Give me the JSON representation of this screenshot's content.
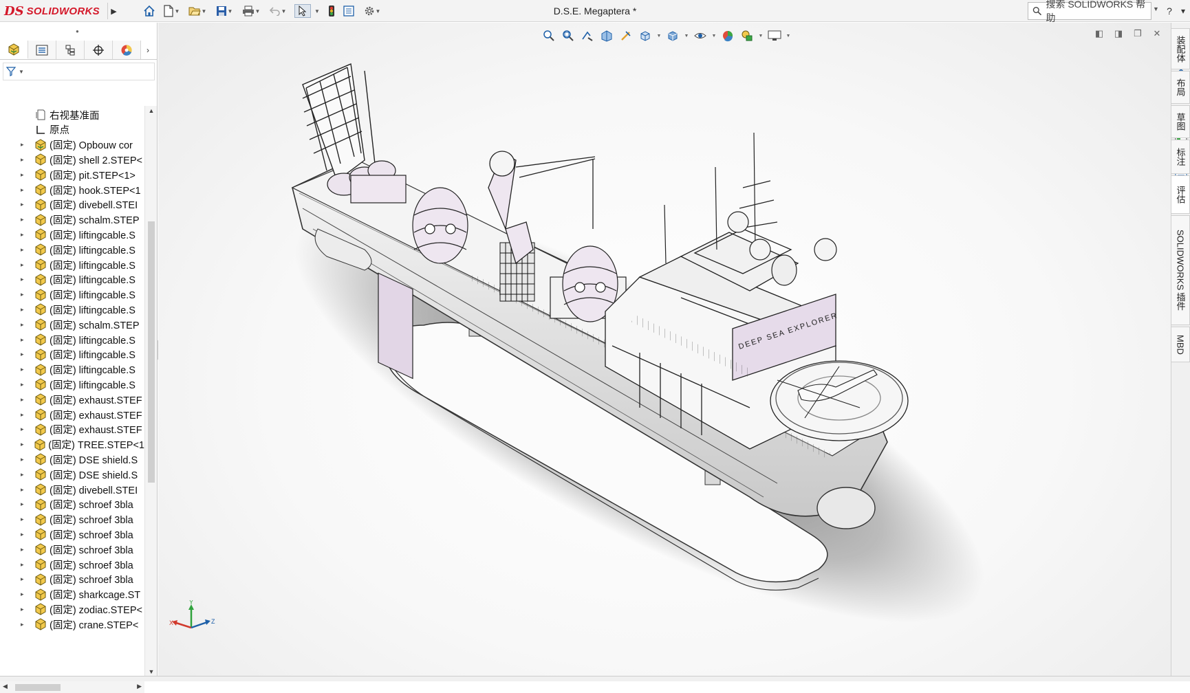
{
  "app": {
    "brand": "SOLIDWORKS",
    "brand_mark": "DS",
    "document_title": "D.S.E. Megaptera *",
    "search_placeholder": "搜索 SOLIDWORKS 帮助"
  },
  "toolbar": {
    "items": [
      "home-icon",
      "new-document-icon",
      "open-icon",
      "save-icon",
      "print-icon",
      "undo-icon",
      "select-pointer-icon",
      "traffic-light-icon",
      "file-properties-icon",
      "options-gear-icon"
    ]
  },
  "feature_manager": {
    "tabs": [
      "feature-manager-tab",
      "property-manager-tab",
      "configuration-manager-tab",
      "dimxpert-manager-tab",
      "display-manager-tab"
    ],
    "filter_icon": "funnel-icon",
    "tree": [
      {
        "label": "右视基准面",
        "icon": "plane-icon",
        "expandable": false
      },
      {
        "label": "原点",
        "icon": "origin-icon",
        "expandable": false
      },
      {
        "label": "(固定) Opbouw cor",
        "icon": "assembly-icon",
        "expandable": true
      },
      {
        "label": "(固定) shell 2.STEP<",
        "icon": "part-icon",
        "expandable": true
      },
      {
        "label": "(固定) pit.STEP<1>",
        "icon": "part-icon",
        "expandable": true
      },
      {
        "label": "(固定) hook.STEP<1",
        "icon": "part-icon",
        "expandable": true
      },
      {
        "label": "(固定) divebell.STEI",
        "icon": "part-icon",
        "expandable": true
      },
      {
        "label": "(固定) schalm.STEP",
        "icon": "part-icon",
        "expandable": true
      },
      {
        "label": "(固定) liftingcable.S",
        "icon": "part-icon",
        "expandable": true
      },
      {
        "label": "(固定) liftingcable.S",
        "icon": "part-icon",
        "expandable": true
      },
      {
        "label": "(固定) liftingcable.S",
        "icon": "part-icon",
        "expandable": true
      },
      {
        "label": "(固定) liftingcable.S",
        "icon": "part-icon",
        "expandable": true
      },
      {
        "label": "(固定) liftingcable.S",
        "icon": "part-icon",
        "expandable": true
      },
      {
        "label": "(固定) liftingcable.S",
        "icon": "part-icon",
        "expandable": true
      },
      {
        "label": "(固定) schalm.STEP",
        "icon": "part-icon",
        "expandable": true
      },
      {
        "label": "(固定) liftingcable.S",
        "icon": "part-icon",
        "expandable": true
      },
      {
        "label": "(固定) liftingcable.S",
        "icon": "part-icon",
        "expandable": true
      },
      {
        "label": "(固定) liftingcable.S",
        "icon": "part-icon",
        "expandable": true
      },
      {
        "label": "(固定) liftingcable.S",
        "icon": "part-icon",
        "expandable": true
      },
      {
        "label": "(固定) exhaust.STEF",
        "icon": "part-icon",
        "expandable": true
      },
      {
        "label": "(固定) exhaust.STEF",
        "icon": "part-icon",
        "expandable": true
      },
      {
        "label": "(固定) exhaust.STEF",
        "icon": "part-icon",
        "expandable": true
      },
      {
        "label": "(固定) TREE.STEP<1",
        "icon": "part-icon",
        "expandable": true
      },
      {
        "label": "(固定) DSE shield.S",
        "icon": "part-icon",
        "expandable": true
      },
      {
        "label": "(固定) DSE shield.S",
        "icon": "part-icon",
        "expandable": true
      },
      {
        "label": "(固定) divebell.STEI",
        "icon": "part-icon",
        "expandable": true
      },
      {
        "label": "(固定) schroef 3bla",
        "icon": "part-icon",
        "expandable": true
      },
      {
        "label": "(固定) schroef 3bla",
        "icon": "part-icon",
        "expandable": true
      },
      {
        "label": "(固定) schroef 3bla",
        "icon": "part-icon",
        "expandable": true
      },
      {
        "label": "(固定) schroef 3bla",
        "icon": "part-icon",
        "expandable": true
      },
      {
        "label": "(固定) schroef 3bla",
        "icon": "part-icon",
        "expandable": true
      },
      {
        "label": "(固定) schroef 3bla",
        "icon": "part-icon",
        "expandable": true
      },
      {
        "label": "(固定) sharkcage.ST",
        "icon": "part-icon",
        "expandable": true
      },
      {
        "label": "(固定) zodiac.STEP<",
        "icon": "part-icon",
        "expandable": true
      },
      {
        "label": "(固定) crane.STEP<",
        "icon": "part-icon",
        "expandable": true
      }
    ]
  },
  "viewport": {
    "hud_items": [
      "zoom-to-fit-icon",
      "zoom-to-area-icon",
      "previous-view-icon",
      "section-view-icon",
      "dynamic-annotation-icon",
      "view-orientation-icon",
      "display-style-icon",
      "hide-show-icon",
      "edit-appearance-icon",
      "apply-scene-icon",
      "view-settings-icon"
    ],
    "hull_text": "DEEP SEA EXPLORER",
    "triad_labels": {
      "x": "X",
      "y": "Y",
      "z": "Z"
    }
  },
  "task_pane": {
    "buttons": [
      "solidworks-resources-icon",
      "design-library-icon",
      "file-explorer-icon",
      "view-palette-icon",
      "appearances-icon",
      "custom-properties-icon",
      "forum-icon"
    ],
    "side_tabs": [
      "装配体",
      "布局",
      "草图",
      "标注",
      "评估",
      "SOLIDWORKS 插件",
      "MBD"
    ]
  },
  "colors": {
    "brand_red": "#d4182a",
    "model_lilac": "#e8dcea",
    "model_line": "#333333"
  }
}
